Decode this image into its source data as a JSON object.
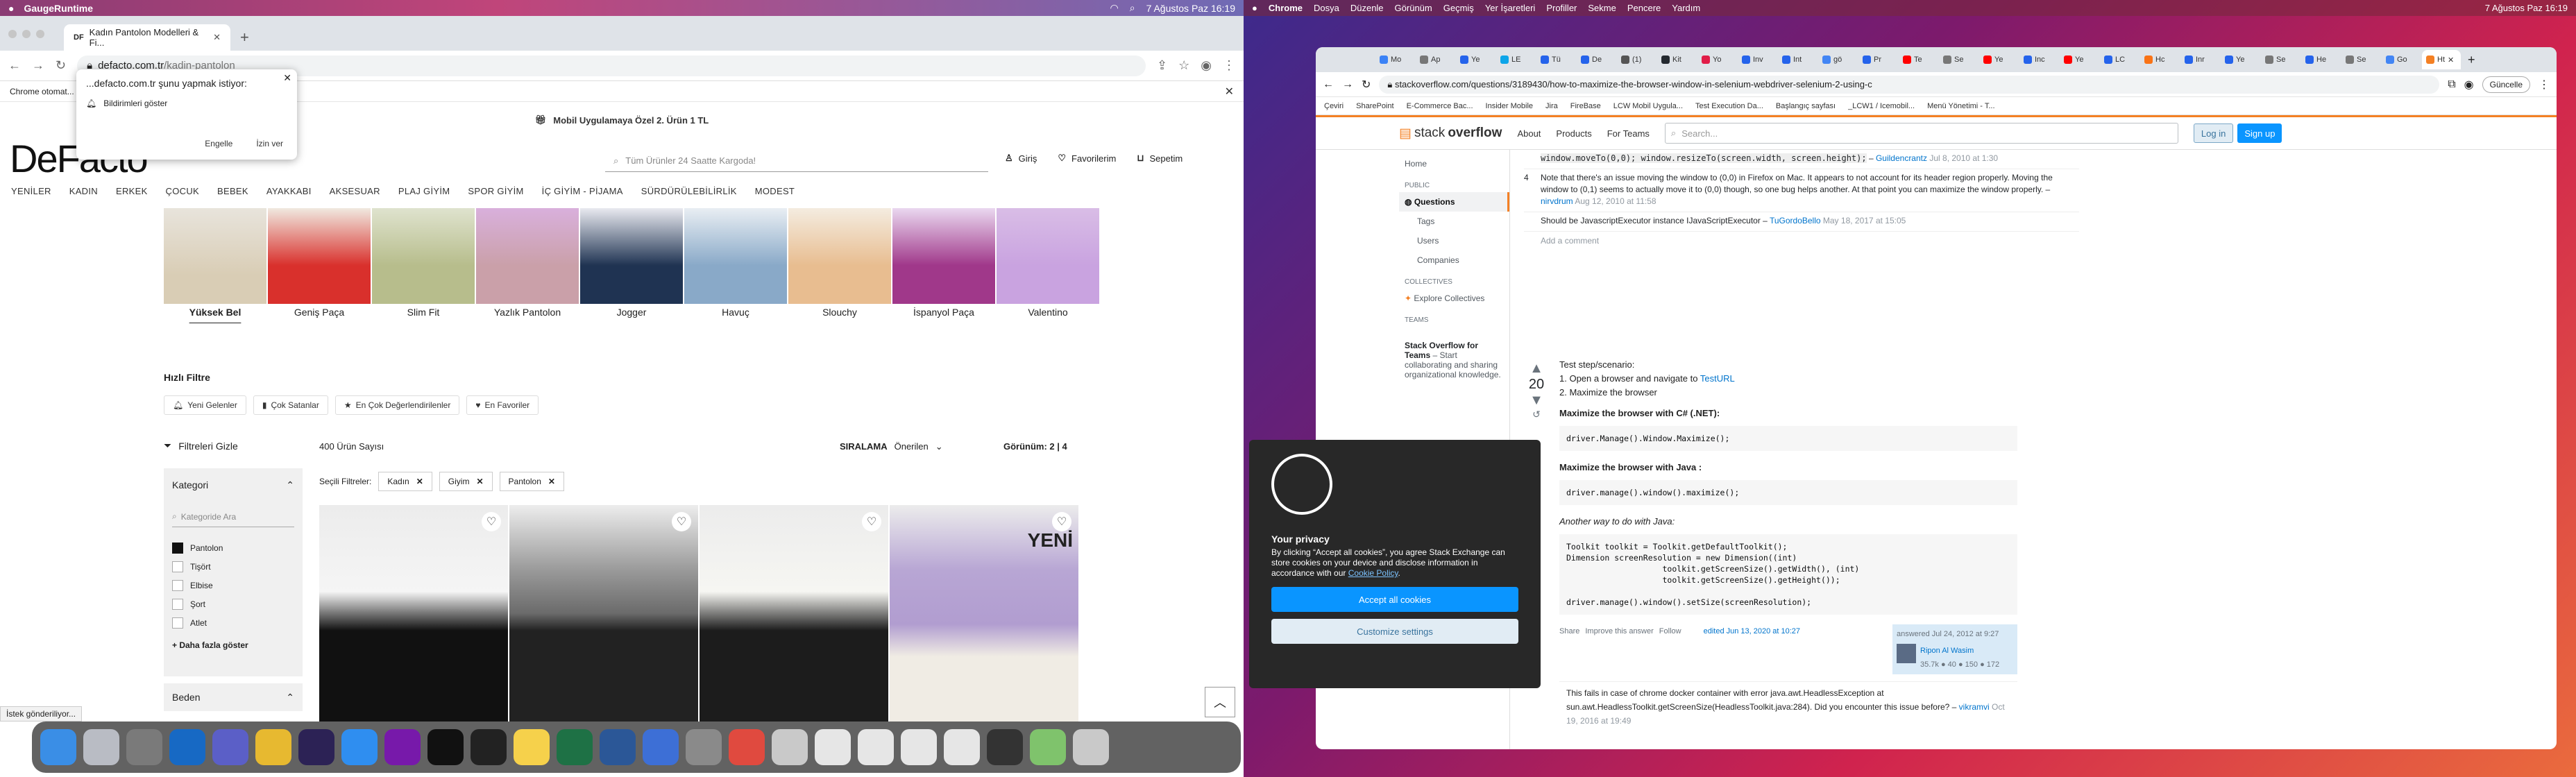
{
  "left": {
    "menubar": {
      "app": "GaugeRuntime",
      "date": "7 Ağustos Paz 16:19"
    },
    "tab": {
      "title": "Kadın Pantolon Modelleri & Fi..."
    },
    "address": {
      "host": "defacto.com.tr",
      "path": "/kadin-pantolon"
    },
    "infobar": {
      "text": "Chrome otomat..."
    },
    "popup": {
      "title": "...defacto.com.tr şunu yapmak istiyor:",
      "row": "Bildirimleri göster",
      "block": "Engelle",
      "allow": "İzin ver"
    },
    "promo": "Mobil Uygulamaya Özel 2. Ürün 1 TL",
    "logo": "DeFacto",
    "search": {
      "placeholder": "Tüm Ürünler 24 Saatte Kargoda!"
    },
    "header": {
      "login": "Giriş",
      "favorites": "Favorilerim",
      "cart": "Sepetim"
    },
    "nav": [
      "YENİLER",
      "KADIN",
      "ERKEK",
      "ÇOCUK",
      "BEBEK",
      "AYAKKABI",
      "AKSESUAR",
      "PLAJ GİYİM",
      "SPOR GİYİM",
      "İÇ GİYİM - PİJAMA",
      "SÜRDÜRÜLEBİLİRLİK",
      "MODEST"
    ],
    "styles": [
      "Yüksek Bel",
      "Geniş Paça",
      "Slim Fit",
      "Yazlık Pantolon",
      "Jogger",
      "Havuç",
      "Slouchy",
      "İspanyol Paça",
      "Valentino"
    ],
    "quick": {
      "title": "Hızlı Filtre",
      "chips": [
        "Yeni Gelenler",
        "Çok Satanlar",
        "En Çok Değerlendirilenler",
        "En Favoriler"
      ]
    },
    "filter_hide": "Filtreleri Gizle",
    "count": "400 Ürün Sayısı",
    "sort": {
      "label": "SIRALAMA",
      "value": "Önerilen"
    },
    "view": "Görünüm: 2 | 4",
    "selected": {
      "label": "Seçili Filtreler:",
      "tags": [
        "Kadın",
        "Giyim",
        "Pantolon"
      ]
    },
    "category": {
      "title": "Kategori",
      "search": "Kategoride Ara",
      "items": [
        "Pantolon",
        "Tişört",
        "Elbise",
        "Şort",
        "Atlet"
      ],
      "more": "+ Daha fazla göster"
    },
    "size": {
      "title": "Beden"
    },
    "status": "İstek gönderiliyor...",
    "badge": "YENİ"
  },
  "right": {
    "menubar": {
      "items": [
        "Chrome",
        "Dosya",
        "Düzenle",
        "Görünüm",
        "Geçmiş",
        "Yer İşaretleri",
        "Profiller",
        "Sekme",
        "Pencere",
        "Yardım"
      ],
      "date": "7 Ağustos Paz 16:19"
    },
    "tabs": [
      "Mo",
      "Ap",
      "Ye",
      "LE",
      "Tü",
      "De",
      "(1)",
      "Kit",
      "Yo",
      "Inv",
      "Int",
      "gö",
      "Pr",
      "Te",
      "Se",
      "Ye",
      "Inc",
      "Ye",
      "LC",
      "Hc",
      "Inr",
      "Ye",
      "Se",
      "He",
      "Se",
      "Go",
      "Ht"
    ],
    "address": "stackoverflow.com/questions/3189430/how-to-maximize-the-browser-window-in-selenium-webdriver-selenium-2-using-c",
    "update": "Güncelle",
    "bookmarks": [
      "Çeviri",
      "SharePoint",
      "E-Commerce Bac...",
      "Insider Mobile",
      "Jira",
      "FireBase",
      "LCW Mobil Uygula...",
      "Test Execution Da...",
      "Başlangıç sayfası",
      "_LCW1 / Icemobil...",
      "Menü Yönetimi - T..."
    ],
    "so": {
      "logo_a": "stack",
      "logo_b": "overflow",
      "about": "About",
      "products": "Products",
      "teams": "For Teams",
      "search": "Search...",
      "login": "Log in",
      "signup": "Sign up"
    },
    "leftnav": {
      "home": "Home",
      "public": "PUBLIC",
      "questions": "Questions",
      "tags": "Tags",
      "users": "Users",
      "companies": "Companies",
      "collectives": "COLLECTIVES",
      "explore": "Explore Collectives",
      "teams": "TEAMS",
      "teams_title": "Stack Overflow for Teams",
      "teams_text": "– Start collaborating and sharing organizational knowledge."
    },
    "comments": [
      {
        "text": "window.moveTo(0,0); window.resizeTo(screen.width, screen.height);",
        "user": "Guildencrantz",
        "date": "Jul 8, 2010 at 1:30"
      },
      {
        "score": "4",
        "text": "Note that there's an issue moving the window to (0,0) in Firefox on Mac. It appears to not account for its header region properly. Moving the window to (0,1) seems to actually move it to (0,0) though, so one bug helps another. At that point you can maximize the window properly.",
        "user": "nirvdrum",
        "date": "Aug 12, 2010 at 11:58"
      },
      {
        "text": "Should be JavascriptExecutor instance IJavaScriptExecutor",
        "user": "TuGordoBello",
        "date": "May 18, 2017 at 15:05"
      }
    ],
    "add_comment": "Add a comment",
    "answer": {
      "votes": "20",
      "scenario": "Test step/scenario:",
      "step1": "1. Open a browser and navigate to",
      "step1_link": "TestURL",
      "step2": "2. Maximize the browser",
      "h1": "Maximize the browser with C# (.NET):",
      "code1": "driver.Manage().Window.Maximize();",
      "h2": "Maximize the browser with Java :",
      "code2": "driver.manage().window().maximize();",
      "h3": "Another way to do with Java:",
      "code3": "Toolkit toolkit = Toolkit.getDefaultToolkit();\nDimension screenResolution = new Dimension((int)\n                    toolkit.getScreenSize().getWidth(), (int)\n                    toolkit.getScreenSize().getHeight());\n\ndriver.manage().window().setSize(screenResolution);",
      "share": "Share",
      "improve": "Improve this answer",
      "follow": "Follow",
      "edited": "edited Jun 13, 2020 at 10:27",
      "answered": "answered Jul 24, 2012 at 9:27",
      "author": "Ripon Al Wasim",
      "rep": "35.7k  ● 40 ● 150 ● 172"
    },
    "comment2": {
      "text": "This fails in case of chrome docker container with error java.awt.HeadlessException at sun.awt.HeadlessToolkit.getScreenSize(HeadlessToolkit.java:284). Did you encounter this issue before?",
      "user": "vikramvi",
      "date": "Oct 19, 2016 at 19:49"
    },
    "cookie": {
      "title": "Your privacy",
      "text": "By clicking “Accept all cookies”, you agree Stack Exchange can store cookies on your device and disclose information in accordance with our",
      "link": "Cookie Policy",
      "accept": "Accept all cookies",
      "customize": "Customize settings"
    }
  },
  "colors": {
    "so_orange": "#f48024",
    "so_blue": "#0a95ff",
    "defacto_black": "#111111"
  }
}
